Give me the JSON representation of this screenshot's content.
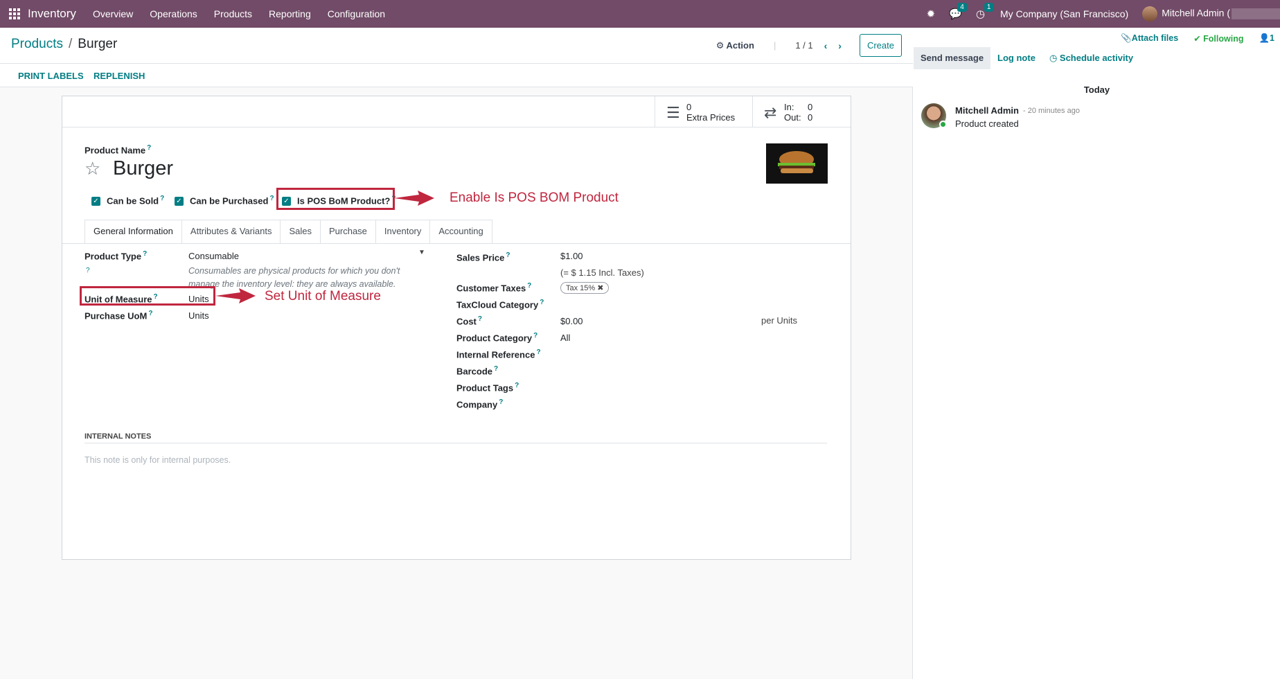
{
  "topnav": {
    "app_name": "Inventory",
    "menu": [
      "Overview",
      "Operations",
      "Products",
      "Reporting",
      "Configuration"
    ],
    "messages_count": "4",
    "activities_count": "1",
    "company": "My Company (San Francisco)",
    "user": "Mitchell Admin (",
    "icons": [
      "apps-grid-icon",
      "bug-icon",
      "chat-icon",
      "clock-icon"
    ]
  },
  "breadcrumb": {
    "parent": "Products",
    "sep": "/",
    "current": "Burger"
  },
  "control": {
    "action_label": "Action",
    "pager": "1 / 1",
    "create_label": "Create"
  },
  "statusbar": {
    "print_labels": "PRINT LABELS",
    "replenish": "REPLENISH"
  },
  "smart_buttons": {
    "extra_prices": {
      "count": "0",
      "label": "Extra Prices"
    },
    "in_out": {
      "in_label": "In:",
      "in_value": "0",
      "out_label": "Out:",
      "out_value": "0"
    }
  },
  "product": {
    "name_label": "Product Name",
    "name": "Burger",
    "can_be_sold": "Can be Sold",
    "can_be_purchased": "Can be Purchased",
    "is_pos_bom": "Is POS BoM Product?"
  },
  "tabs": [
    "General Information",
    "Attributes & Variants",
    "Sales",
    "Purchase",
    "Inventory",
    "Accounting"
  ],
  "left_fields": {
    "product_type_label": "Product Type",
    "product_type_value": "Consumable",
    "product_type_desc": "Consumables are physical products for which you don't manage the inventory level: they are always available.",
    "uom_label": "Unit of Measure",
    "uom_value": "Units",
    "purchase_uom_label": "Purchase UoM",
    "purchase_uom_value": "Units"
  },
  "right_fields": {
    "sales_price_label": "Sales Price",
    "sales_price_value": "$1.00",
    "incl_taxes": "(= $ 1.15 Incl. Taxes)",
    "customer_taxes_label": "Customer Taxes",
    "tax_tag": "Tax 15%",
    "taxcloud_label": "TaxCloud Category",
    "cost_label": "Cost",
    "cost_value": "$0.00",
    "per_units": "per Units",
    "category_label": "Product Category",
    "category_value": "All",
    "internal_ref_label": "Internal Reference",
    "barcode_label": "Barcode",
    "tags_label": "Product Tags",
    "company_label": "Company"
  },
  "notes": {
    "header": "INTERNAL NOTES",
    "placeholder": "This note is only for internal purposes."
  },
  "annotations": {
    "pos_bom": "Enable Is POS BOM Product",
    "uom": "Set Unit of Measure",
    "color": "#c0263e"
  },
  "chatter": {
    "attach_files": "Attach files",
    "following": "Following",
    "followers_count": "1",
    "send_message": "Send message",
    "log_note": "Log note",
    "schedule_activity": "Schedule activity",
    "today": "Today",
    "author": "Mitchell Admin",
    "time": "- 20 minutes ago",
    "message": "Product created"
  },
  "colors": {
    "brand": "#714b67",
    "accent": "#017e84"
  }
}
